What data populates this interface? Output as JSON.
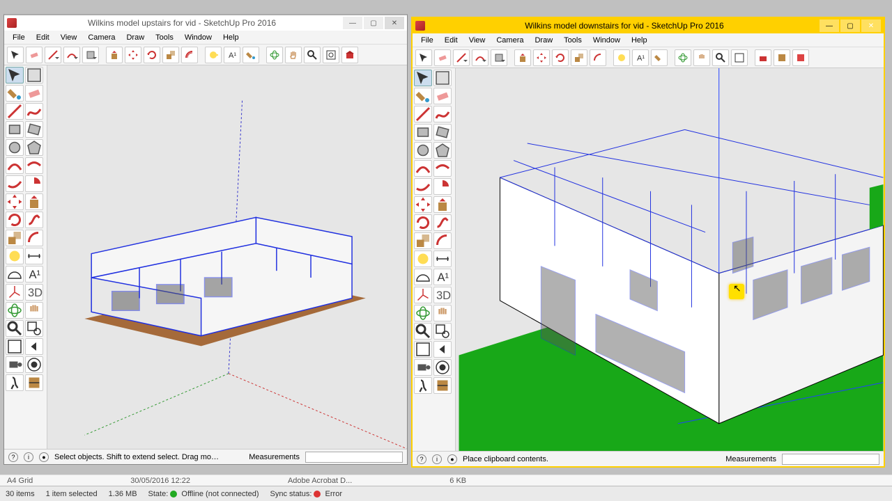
{
  "left_window": {
    "title": "Wilkins model upstairs for vid - SketchUp Pro 2016",
    "menus": [
      "File",
      "Edit",
      "View",
      "Camera",
      "Draw",
      "Tools",
      "Window",
      "Help"
    ],
    "status_hint": "Select objects. Shift to extend select. Drag mous...",
    "measurements_label": "Measurements"
  },
  "right_window": {
    "title": "Wilkins model downstairs for vid - SketchUp Pro 2016",
    "menus": [
      "File",
      "Edit",
      "View",
      "Camera",
      "Draw",
      "Tools",
      "Window",
      "Help"
    ],
    "status_hint": "Place clipboard contents.",
    "measurements_label": "Measurements"
  },
  "win_buttons": {
    "min": "—",
    "max": "▢",
    "close": "✕"
  },
  "side_tools": [
    "select-icon",
    "make-component-icon",
    "paint-bucket-icon",
    "eraser-icon",
    "line-icon",
    "freehand-icon",
    "rectangle-icon",
    "rotated-rect-icon",
    "circle-icon",
    "polygon-icon",
    "arc-icon",
    "2pt-arc-icon",
    "3pt-arc-icon",
    "pie-icon",
    "move-icon",
    "push-pull-icon",
    "rotate-icon",
    "follow-me-icon",
    "scale-icon",
    "offset-icon",
    "tape-icon",
    "dimension-icon",
    "protractor-icon",
    "text-icon",
    "axes-icon",
    "3dtext-icon",
    "orbit-icon",
    "pan-icon",
    "zoom-icon",
    "zoom-window-icon",
    "zoom-extents-icon",
    "previous-icon",
    "position-camera-icon",
    "look-around-icon",
    "walk-icon",
    "section-icon"
  ],
  "top_tools": [
    "select-icon",
    "eraser-icon",
    "line-icon",
    "arc-icon",
    "shape-icon",
    "push-pull-icon",
    "move-icon",
    "rotate-icon",
    "scale-icon",
    "offset-icon",
    "tape-icon",
    "text-icon",
    "paint-icon",
    "orbit-icon",
    "pan-icon",
    "zoom-icon",
    "zoom-extents-icon",
    "warehouse-icon"
  ],
  "taskbar": {
    "items": "30 items",
    "selected": "1 item selected",
    "size": "1.36 MB",
    "state_label": "State:",
    "state_value": "Offline (not connected)",
    "sync_label": "Sync status:",
    "sync_value": "Error"
  },
  "peek": {
    "a": "A4 Grid",
    "b": "30/05/2016 12:22",
    "c": "Adobe Acrobat D...",
    "d": "6 KB"
  }
}
